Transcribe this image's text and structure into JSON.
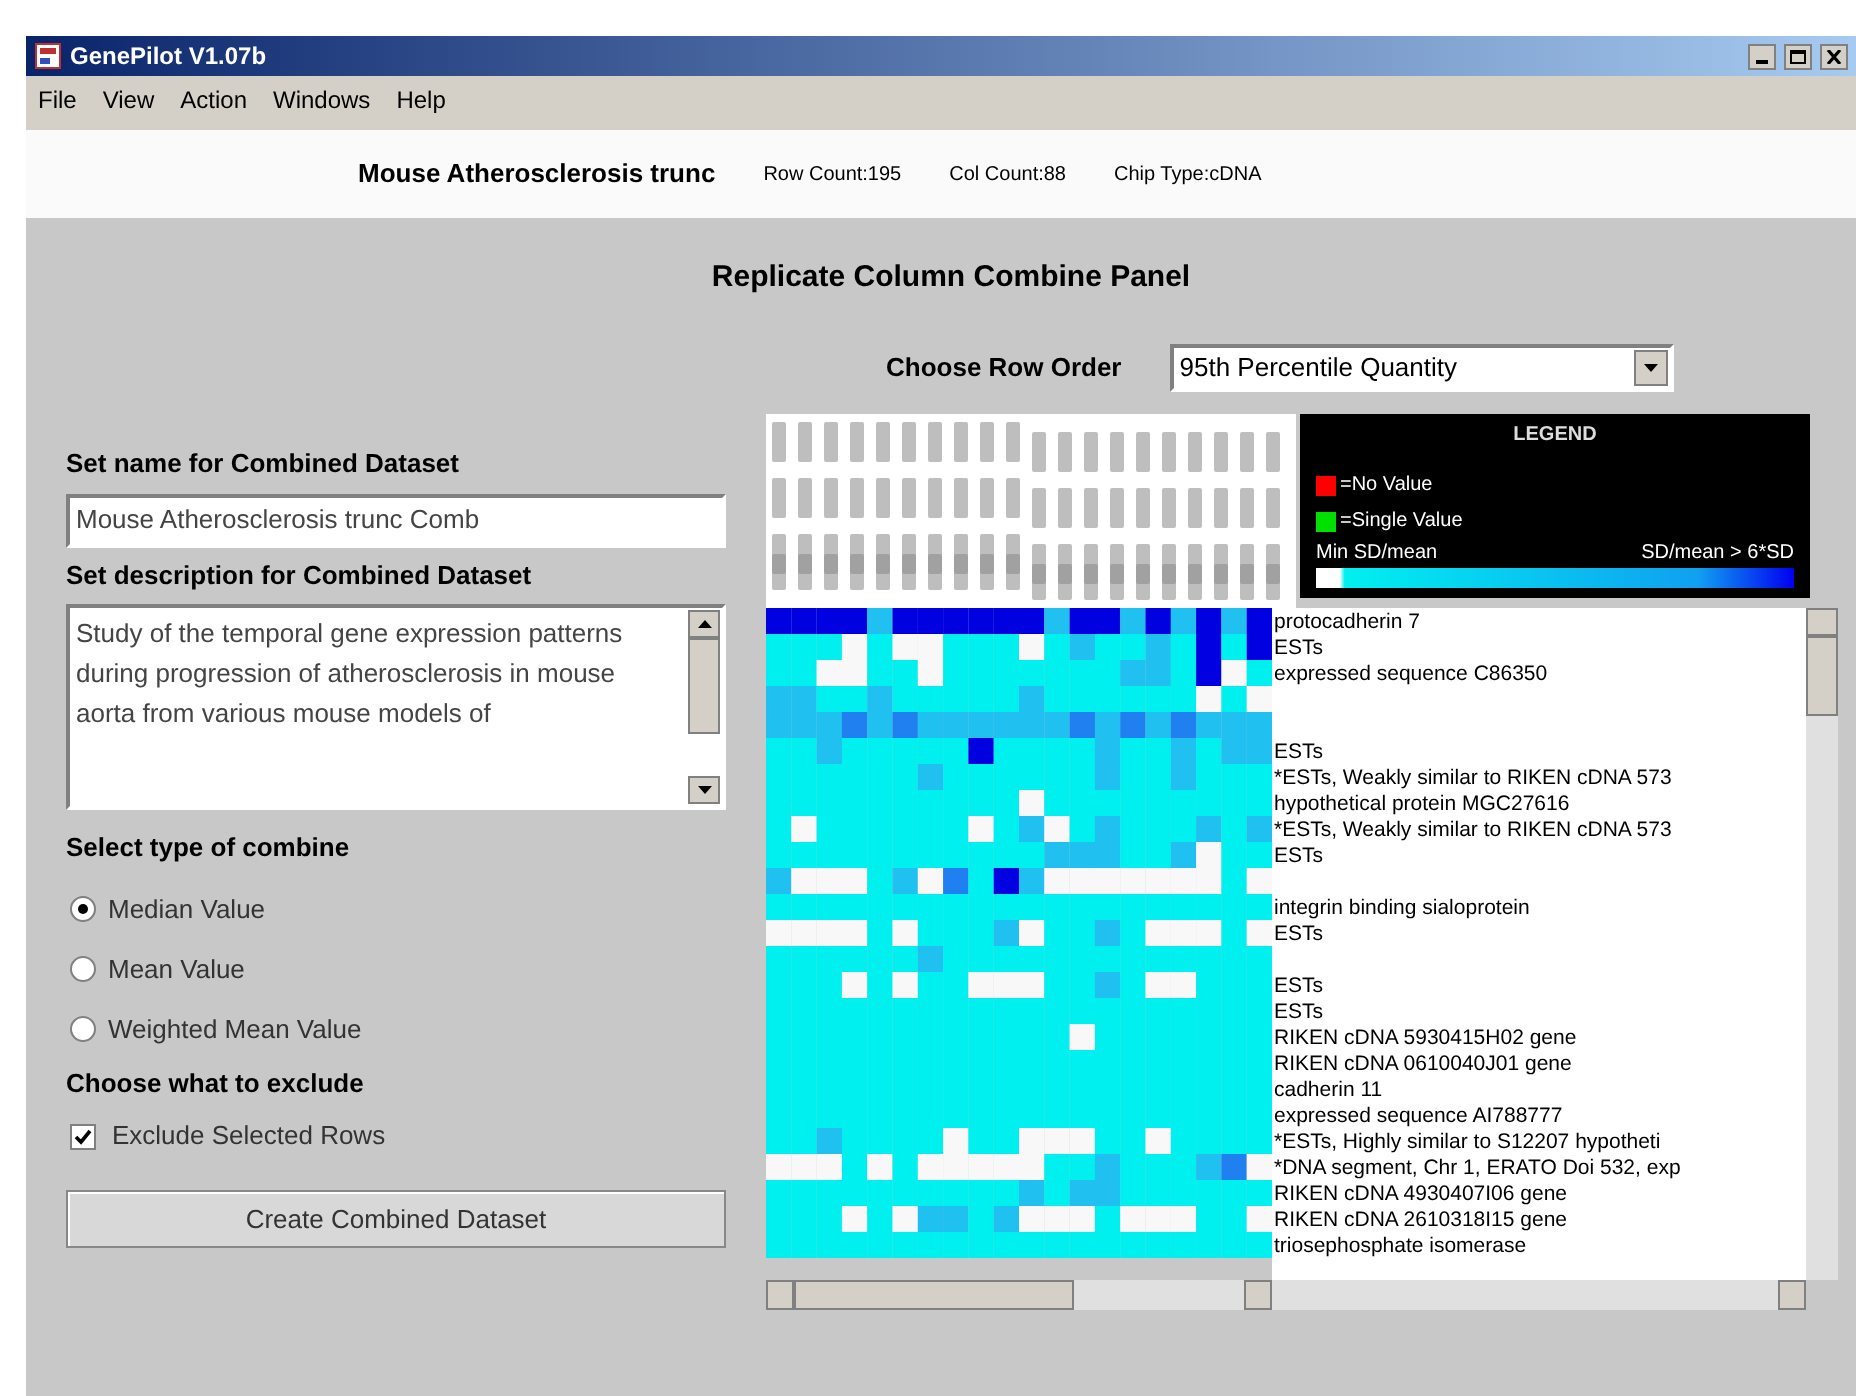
{
  "window": {
    "title": "GenePilot V1.07b"
  },
  "menu": [
    {
      "label": "File"
    },
    {
      "label": "View"
    },
    {
      "label": "Action"
    },
    {
      "label": "Windows"
    },
    {
      "label": "Help"
    }
  ],
  "header": {
    "dataset": "Mouse Atherosclerosis trunc",
    "row_count": "Row Count:195",
    "col_count": "Col Count:88",
    "chip_type": "Chip Type:cDNA"
  },
  "panel": {
    "title": "Replicate Column Combine Panel"
  },
  "form": {
    "name_label": "Set name for Combined Dataset",
    "name_value": "Mouse Atherosclerosis trunc Comb",
    "description_label": "Set description for Combined Dataset",
    "description_value": "Study of the temporal gene expression patterns during progression of atherosclerosis in mouse aorta from various mouse models of",
    "combine_label": "Select type of combine",
    "combine_options": [
      {
        "label": "Median Value",
        "selected": true
      },
      {
        "label": "Mean Value",
        "selected": false
      },
      {
        "label": "Weighted Mean Value",
        "selected": false
      }
    ],
    "exclude_label": "Choose what to exclude",
    "exclude": {
      "label": "Exclude Selected Rows",
      "checked": true
    },
    "button": "Create Combined Dataset"
  },
  "row_order": {
    "label": "Choose Row Order",
    "value": "95th Percentile Quantity"
  },
  "legend": {
    "title": "LEGEND",
    "items": [
      {
        "label": "=No Value",
        "color": "#ff0000"
      },
      {
        "label": "=Single Value",
        "color": "#00e000"
      }
    ],
    "min_label": "Min SD/mean",
    "max_label": "SD/mean > 6*SD"
  },
  "genes": [
    {
      "label": "protocadherin 7"
    },
    {
      "label": "ESTs"
    },
    {
      "label": "expressed sequence C86350"
    },
    {
      "kind": "blank"
    },
    {
      "kind": "blank"
    },
    {
      "label": "ESTs"
    },
    {
      "label": "*ESTs, Weakly similar to RIKEN cDNA 573"
    },
    {
      "label": "hypothetical protein MGC27616"
    },
    {
      "label": "*ESTs, Weakly similar to RIKEN cDNA 573"
    },
    {
      "label": "ESTs"
    },
    {
      "kind": "blank"
    },
    {
      "label": "integrin binding sialoprotein"
    },
    {
      "label": "ESTs"
    },
    {
      "kind": "blank"
    },
    {
      "label": "ESTs"
    },
    {
      "label": "ESTs"
    },
    {
      "label": "RIKEN cDNA 5930415H02 gene"
    },
    {
      "label": "RIKEN cDNA 0610040J01 gene"
    },
    {
      "label": "cadherin 11"
    },
    {
      "label": "expressed sequence AI788777"
    },
    {
      "label": "*ESTs, Highly similar to S12207 hypotheti"
    },
    {
      "label": "*DNA segment, Chr 1, ERATO Doi 532, exp"
    },
    {
      "label": "RIKEN cDNA 4930407I06 gene"
    },
    {
      "label": "RIKEN cDNA 2610318I15 gene"
    },
    {
      "label": "triosephosphate isomerase"
    }
  ]
}
